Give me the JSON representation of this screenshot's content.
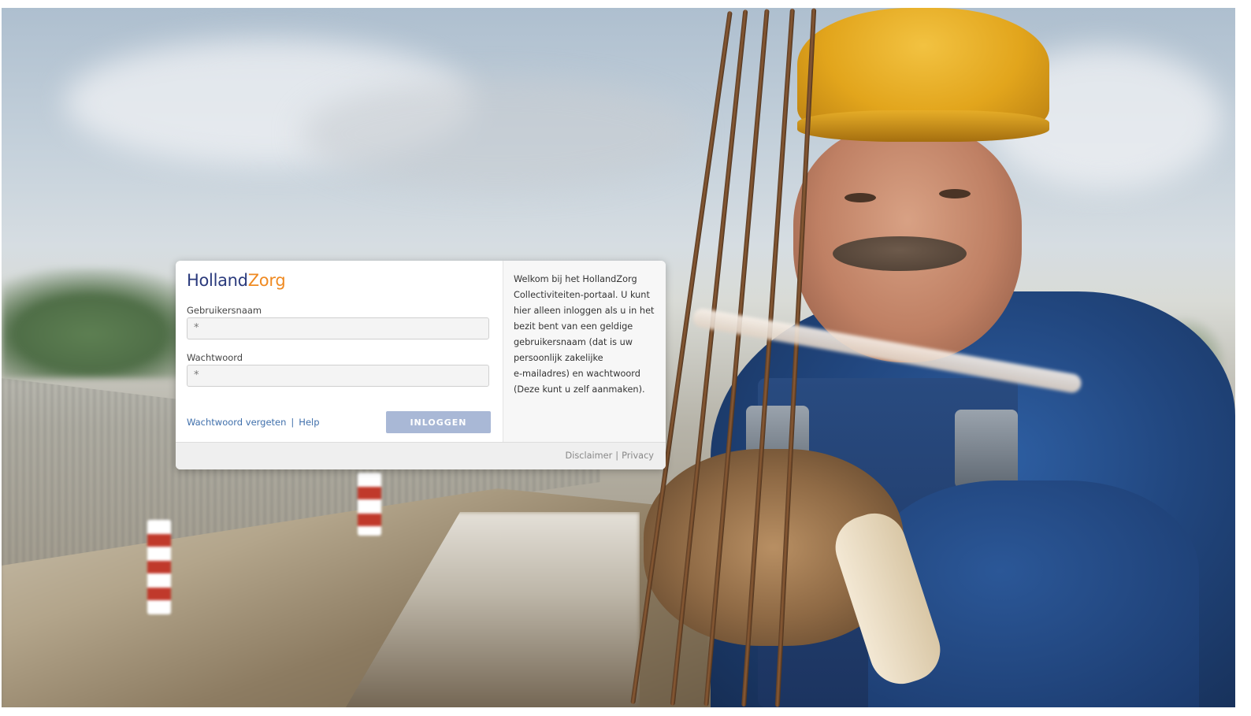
{
  "brand": {
    "part1": "Holland",
    "part2": "Zorg",
    "color_primary": "#2a3a7c",
    "color_accent": "#ef8a22"
  },
  "form": {
    "username_label": "Gebruikersnaam",
    "username_value": "*",
    "password_label": "Wachtwoord",
    "password_value": "*",
    "forgot_link": "Wachtwoord vergeten",
    "separator": "|",
    "help_link": "Help",
    "login_button": "INLOGGEN",
    "login_button_color": "#a9b8d6"
  },
  "welcome_text": "Welkom bij het HollandZorg\nCollectiviteiten-portaal. U kunt\nhier alleen inloggen als u in het\nbezit bent van een geldige\ngebruikersnaam (dat is uw\npersoonlijk zakelijke\ne-mailadres) en wachtwoord\n(Deze kunt u zelf aanmaken).",
  "footer": {
    "disclaimer": "Disclaimer",
    "separator": "|",
    "privacy": "Privacy"
  },
  "background": {
    "image": "construction-worker-photo"
  }
}
